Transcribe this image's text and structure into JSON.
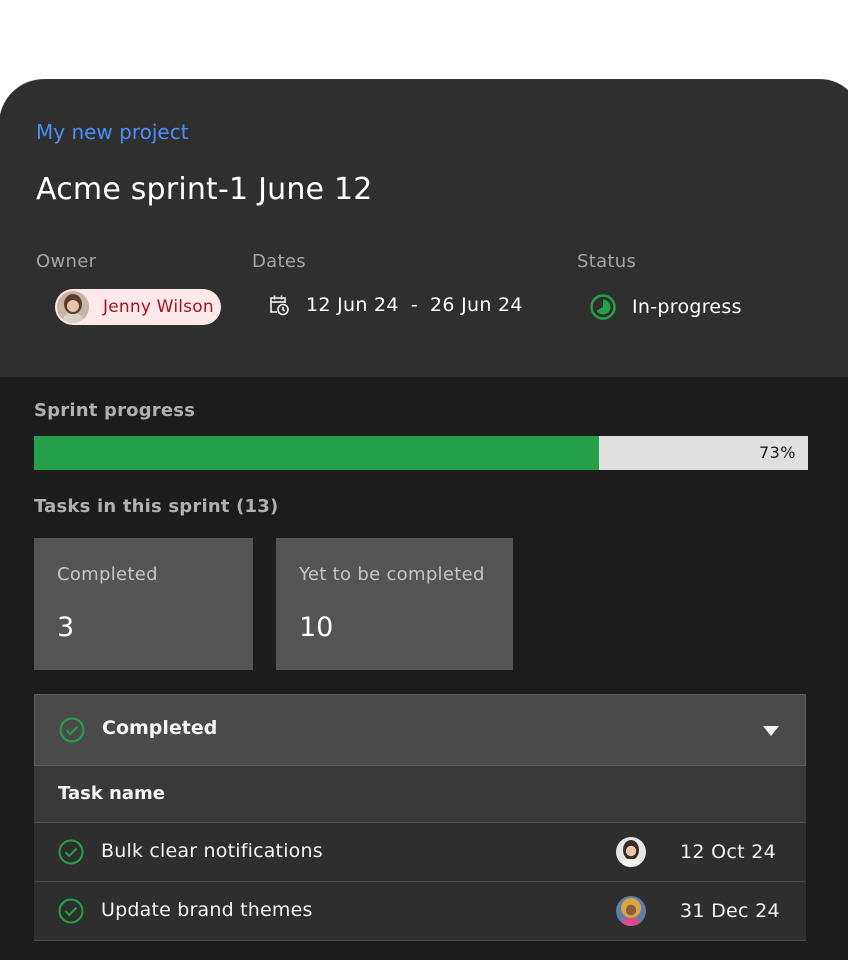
{
  "breadcrumb": "My new project",
  "title": "Acme sprint-1 June 12",
  "fields": {
    "owner_label": "Owner",
    "dates_label": "Dates",
    "status_label": "Status"
  },
  "owner": {
    "name": "Jenny Wilson",
    "avatar": "user-avatar"
  },
  "dates": {
    "start": "12 Jun 24",
    "separator": "-",
    "end": "26 Jun 24",
    "icon": "calendar-clock-icon"
  },
  "status": {
    "label": "In-progress",
    "icon": "in-progress-icon",
    "color": "#24a148"
  },
  "progress": {
    "label": "Sprint progress",
    "value": 73,
    "text": "73%",
    "color": "#24a148"
  },
  "tasks_heading": "Tasks in this sprint (13)",
  "stats": [
    {
      "label": "Completed",
      "value": "3"
    },
    {
      "label": "Yet to be completed",
      "value": "10"
    }
  ],
  "completed_section": {
    "title": "Completed",
    "icon": "checkmark-outline-icon",
    "column_header": "Task name",
    "rows": [
      {
        "name": "Bulk clear notifications",
        "date": "12 Oct 24",
        "avatar": "assignee-avatar"
      },
      {
        "name": "Update brand themes",
        "date": "31 Dec 24",
        "avatar": "assignee-avatar"
      }
    ]
  },
  "colors": {
    "accent_link": "#4d8ef5",
    "success": "#24a148",
    "owner_chip_bg": "#fde9ea",
    "owner_chip_text": "#a1151f"
  }
}
